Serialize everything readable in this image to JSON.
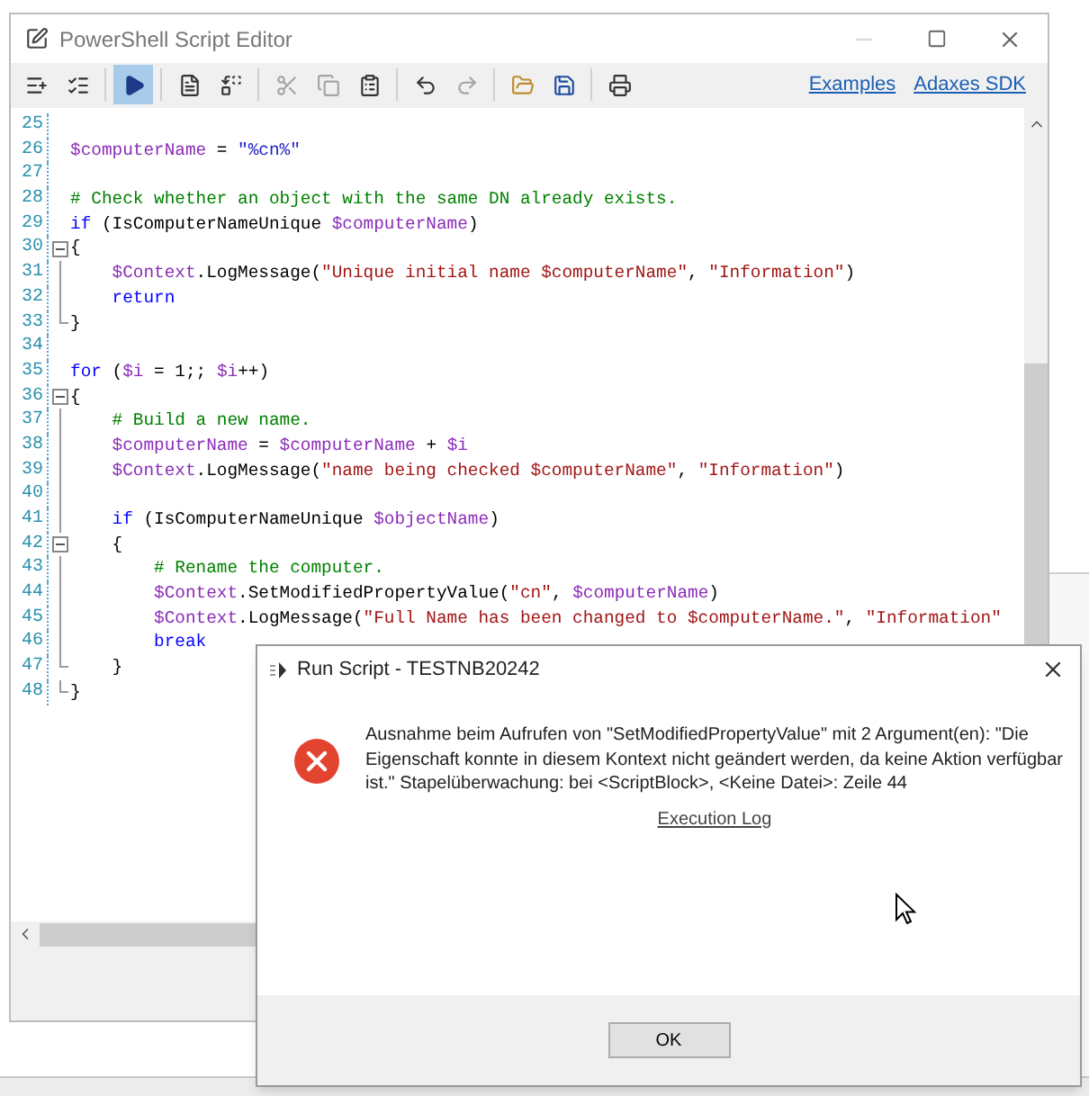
{
  "editor": {
    "title": "PowerShell Script Editor",
    "toolbar": [
      {
        "kind": "add",
        "disabled": false,
        "selected": false
      },
      {
        "kind": "check",
        "disabled": false,
        "selected": false
      },
      {
        "kind": "sep"
      },
      {
        "kind": "run",
        "disabled": false,
        "selected": true
      },
      {
        "kind": "sep"
      },
      {
        "kind": "doc",
        "disabled": false,
        "selected": false
      },
      {
        "kind": "replace",
        "disabled": false,
        "selected": false
      },
      {
        "kind": "sep"
      },
      {
        "kind": "cut",
        "disabled": true,
        "selected": false
      },
      {
        "kind": "copy",
        "disabled": true,
        "selected": false
      },
      {
        "kind": "paste",
        "disabled": false,
        "selected": false
      },
      {
        "kind": "sep"
      },
      {
        "kind": "undo",
        "disabled": false,
        "selected": false
      },
      {
        "kind": "redo",
        "disabled": true,
        "selected": false
      },
      {
        "kind": "sep"
      },
      {
        "kind": "open",
        "disabled": false,
        "selected": false
      },
      {
        "kind": "save",
        "disabled": false,
        "selected": false
      },
      {
        "kind": "sep"
      },
      {
        "kind": "print",
        "disabled": false,
        "selected": false
      }
    ],
    "links": [
      "Examples",
      "Adaxes SDK"
    ],
    "lines": [
      {
        "number": "25",
        "kind": "plain"
      },
      {
        "number": "26",
        "kind": "plain",
        "tokens": [
          {
            "kind": "variable",
            "text": "$computerName"
          },
          {
            "kind": "plain",
            "text": " = "
          },
          {
            "kind": "literal",
            "text": "\"%cn%\""
          }
        ]
      },
      {
        "number": "27",
        "kind": "plain"
      },
      {
        "number": "28",
        "kind": "plain",
        "tokens": [
          {
            "kind": "comment",
            "text": "# Check whether an object with the same DN already exists."
          }
        ]
      },
      {
        "number": "29",
        "kind": "plain",
        "tokens": [
          {
            "kind": "keyword",
            "text": "if"
          },
          {
            "kind": "plain",
            "text": " (IsComputerNameUnique "
          },
          {
            "kind": "variable",
            "text": "$computerName"
          },
          {
            "kind": "plain",
            "text": ")"
          }
        ]
      },
      {
        "number": "30",
        "kind": "fold_open",
        "tokens": [
          {
            "kind": "plain",
            "text": "{"
          }
        ]
      },
      {
        "number": "31",
        "kind": "fold_line",
        "tokens": [
          {
            "kind": "variable",
            "text": "    $Context"
          },
          {
            "kind": "plain",
            "text": ".LogMessage("
          },
          {
            "kind": "string",
            "text": "\"Unique initial name $computerName\""
          },
          {
            "kind": "plain",
            "text": ", "
          },
          {
            "kind": "string",
            "text": "\"Information\""
          },
          {
            "kind": "plain",
            "text": ")"
          }
        ]
      },
      {
        "number": "32",
        "kind": "fold_line",
        "tokens": [
          {
            "kind": "keyword",
            "text": "    return"
          }
        ]
      },
      {
        "number": "33",
        "kind": "fold_end",
        "tokens": [
          {
            "kind": "plain",
            "text": "}"
          }
        ]
      },
      {
        "number": "34",
        "kind": "plain"
      },
      {
        "number": "35",
        "kind": "plain",
        "tokens": [
          {
            "kind": "keyword",
            "text": "for"
          },
          {
            "kind": "plain",
            "text": " ("
          },
          {
            "kind": "variable",
            "text": "$i"
          },
          {
            "kind": "plain",
            "text": " = 1;; "
          },
          {
            "kind": "variable",
            "text": "$i"
          },
          {
            "kind": "plain",
            "text": "++)"
          }
        ]
      },
      {
        "number": "36",
        "kind": "fold_open",
        "tokens": [
          {
            "kind": "plain",
            "text": "{"
          }
        ]
      },
      {
        "number": "37",
        "kind": "fold_line",
        "tokens": [
          {
            "kind": "comment",
            "text": "    # Build a new name."
          }
        ]
      },
      {
        "number": "38",
        "kind": "fold_line",
        "tokens": [
          {
            "kind": "variable",
            "text": "    $computerName"
          },
          {
            "kind": "plain",
            "text": " = "
          },
          {
            "kind": "variable",
            "text": "$computerName"
          },
          {
            "kind": "plain",
            "text": " + "
          },
          {
            "kind": "variable",
            "text": "$i"
          }
        ]
      },
      {
        "number": "39",
        "kind": "fold_line",
        "tokens": [
          {
            "kind": "variable",
            "text": "    $Context"
          },
          {
            "kind": "plain",
            "text": ".LogMessage("
          },
          {
            "kind": "string",
            "text": "\"name being checked $computerName\""
          },
          {
            "kind": "plain",
            "text": ", "
          },
          {
            "kind": "string",
            "text": "\"Information\""
          },
          {
            "kind": "plain",
            "text": ")"
          }
        ]
      },
      {
        "number": "40",
        "kind": "fold_line"
      },
      {
        "number": "41",
        "kind": "fold_line",
        "tokens": [
          {
            "kind": "keyword",
            "text": "    if"
          },
          {
            "kind": "plain",
            "text": " (IsComputerNameUnique "
          },
          {
            "kind": "variable",
            "text": "$objectName"
          },
          {
            "kind": "plain",
            "text": ")"
          }
        ]
      },
      {
        "number": "42",
        "kind": "fold_open",
        "tokens": [
          {
            "kind": "plain",
            "text": "    {"
          }
        ]
      },
      {
        "number": "43",
        "kind": "fold_line",
        "tokens": [
          {
            "kind": "comment",
            "text": "        # Rename the computer."
          }
        ]
      },
      {
        "number": "44",
        "kind": "fold_line",
        "tokens": [
          {
            "kind": "variable",
            "text": "        $Context"
          },
          {
            "kind": "plain",
            "text": ".SetModifiedPropertyValue("
          },
          {
            "kind": "string",
            "text": "\"cn\""
          },
          {
            "kind": "plain",
            "text": ", "
          },
          {
            "kind": "variable",
            "text": "$computerName"
          },
          {
            "kind": "plain",
            "text": ")"
          }
        ]
      },
      {
        "number": "45",
        "kind": "fold_line",
        "tokens": [
          {
            "kind": "variable",
            "text": "        $Context"
          },
          {
            "kind": "plain",
            "text": ".LogMessage("
          },
          {
            "kind": "string",
            "text": "\"Full Name has been changed to $computerName.\""
          },
          {
            "kind": "plain",
            "text": ", "
          },
          {
            "kind": "string",
            "text": "\"Information\""
          }
        ]
      },
      {
        "number": "46",
        "kind": "fold_line",
        "tokens": [
          {
            "kind": "keyword",
            "text": "        break"
          }
        ]
      },
      {
        "number": "47",
        "kind": "fold_end",
        "tokens": [
          {
            "kind": "plain",
            "text": "    }"
          }
        ]
      },
      {
        "number": "48",
        "kind": "fold_end",
        "tokens": [
          {
            "kind": "plain",
            "text": "}"
          }
        ]
      }
    ]
  },
  "dialog": {
    "title": "Run Script - TESTNB20242",
    "message": "Ausnahme beim Aufrufen von \"SetModifiedPropertyValue\" mit 2 Argument(en):  \"Die Eigenschaft konnte in diesem Kontext nicht geändert werden, da keine Aktion verfügbar ist.\" Stapelüberwachung: bei <ScriptBlock>, <Keine Datei>: Zeile 44",
    "link": "Execution Log",
    "button": "OK"
  }
}
